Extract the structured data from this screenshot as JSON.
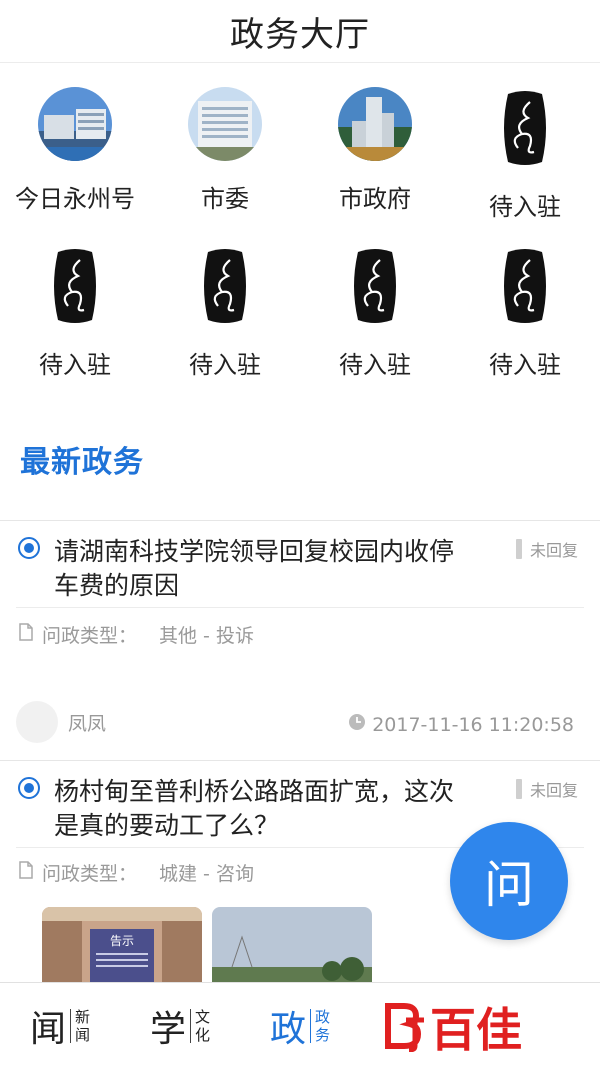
{
  "header": {
    "title": "政务大厅"
  },
  "accounts": [
    {
      "label": "今日永州号",
      "icon": "building-photo"
    },
    {
      "label": "市委",
      "icon": "building-photo"
    },
    {
      "label": "市政府",
      "icon": "building-photo"
    },
    {
      "label": "待入驻",
      "icon": "calligraphy-seal"
    },
    {
      "label": "待入驻",
      "icon": "calligraphy-seal"
    },
    {
      "label": "待入驻",
      "icon": "calligraphy-seal"
    },
    {
      "label": "待入驻",
      "icon": "calligraphy-seal"
    },
    {
      "label": "待入驻",
      "icon": "calligraphy-seal"
    }
  ],
  "section": {
    "title": "最新政务"
  },
  "posts": [
    {
      "title": "请湖南科技学院领导回复校园内收停车费的原因",
      "status": "未回复",
      "type_label": "问政类型：",
      "type_value": "其他 - 投诉",
      "author": "凤凤",
      "time": "2017-11-16 11:20:58"
    },
    {
      "title": "杨村甸至普利桥公路路面扩宽，这次是真的要动工了么？",
      "status": "未回复",
      "type_label": "问政类型：",
      "type_value": "城建 - 咨询",
      "thumb_caption": "告示"
    }
  ],
  "fab": {
    "label": "问"
  },
  "tabs": [
    {
      "big": "闻",
      "small1": "新",
      "small2": "闻",
      "active": false
    },
    {
      "big": "学",
      "small1": "文",
      "small2": "化",
      "active": false
    },
    {
      "big": "政",
      "small1": "政",
      "small2": "务",
      "active": true
    }
  ],
  "watermark": {
    "text": "百佳"
  },
  "colors": {
    "accent": "#1f73d8",
    "fab": "#2f86ec",
    "watermark": "#e02020"
  }
}
